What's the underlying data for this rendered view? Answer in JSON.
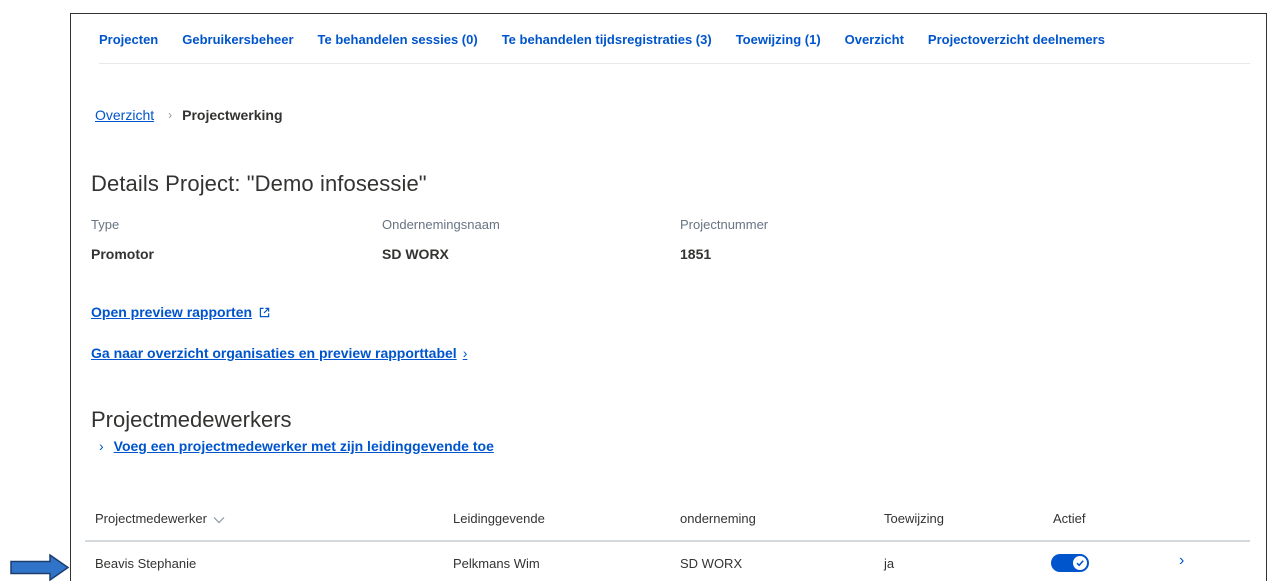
{
  "nav": {
    "items": [
      {
        "label": "Projecten"
      },
      {
        "label": "Gebruikersbeheer"
      },
      {
        "label": "Te behandelen sessies (0)"
      },
      {
        "label": "Te behandelen tijdsregistraties (3)"
      },
      {
        "label": "Toewijzing (1)"
      },
      {
        "label": "Overzicht"
      },
      {
        "label": "Projectoverzicht deelnemers"
      }
    ]
  },
  "breadcrumb": {
    "parent": "Overzicht",
    "current": "Projectwerking"
  },
  "project": {
    "title": "Details Project: \"Demo infosessie\"",
    "fields": [
      {
        "label": "Type",
        "value": "Promotor"
      },
      {
        "label": "Ondernemingsnaam",
        "value": "SD WORX"
      },
      {
        "label": "Projectnummer",
        "value": "1851"
      }
    ]
  },
  "links": {
    "preview_reports": "Open preview rapporten",
    "overview_orgs": "Ga naar overzicht organisaties en preview rapporttabel"
  },
  "staff": {
    "title": "Projectmedewerkers",
    "add_link": "Voeg een projectmedewerker met zijn leidinggevende toe",
    "columns": [
      "Projectmedewerker",
      "Leidinggevende",
      "onderneming",
      "Toewijzing",
      "Actief"
    ],
    "rows": [
      {
        "name": "Beavis Stephanie",
        "manager": "Pelkmans Wim",
        "company": "SD WORX",
        "assignment": "ja",
        "active": true
      }
    ]
  },
  "icons": {
    "external": "external-link-icon",
    "chevron": "chevron-right-icon",
    "sort": "chevron-down-icon",
    "check": "check-icon",
    "pointer": "arrow-right-icon"
  },
  "colors": {
    "link": "#0055cc",
    "text": "#333332",
    "muted": "#687483",
    "arrow": "#2f74c9"
  }
}
